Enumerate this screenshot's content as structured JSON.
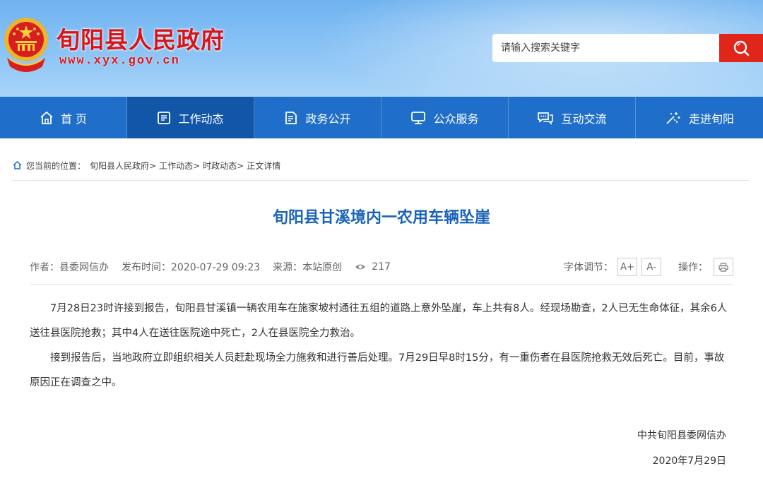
{
  "header": {
    "site_title": "旬阳县人民政府",
    "site_url": "www.xyx.gov.cn",
    "search_placeholder": "请输入搜索关键字",
    "colors": {
      "brand_red": "#d8141b",
      "sky_blue": "#8cc4f5",
      "search_button": "#e0251b"
    }
  },
  "nav": {
    "items": [
      {
        "label": "首 页",
        "icon": "home-icon"
      },
      {
        "label": "工作动态",
        "icon": "document-icon",
        "active": true
      },
      {
        "label": "政务公开",
        "icon": "file-icon"
      },
      {
        "label": "公众服务",
        "icon": "monitor-icon"
      },
      {
        "label": "互动交流",
        "icon": "chat-icon"
      },
      {
        "label": "走进旬阳",
        "icon": "sparkle-icon"
      }
    ],
    "colors": {
      "bar": "#1f6ec9",
      "active": "#1256a8"
    }
  },
  "breadcrumb": {
    "prefix": "您当前的位置：",
    "items": [
      "旬阳县人民政府>",
      "工作动态>",
      "时政动态>",
      "正文详情"
    ]
  },
  "article": {
    "title": "旬阳县甘溪境内一农用车辆坠崖",
    "meta": {
      "author": "作者：县委网信办",
      "published": "发布时间：2020-07-29 09:23",
      "source": "来源：本站原创",
      "views": "217",
      "font_adjust_label": "字体调节：",
      "font_larger": "A+",
      "font_smaller": "A-",
      "operate_label": "操作："
    },
    "paragraphs": [
      "7月28日23时许接到报告，旬阳县甘溪镇一辆农用车在施家坡村通往五组的道路上意外坠崖，车上共有8人。经现场勘查，2人已无生命体征，其余6人送往县医院抢救；其中4人在送往医院途中死亡，2人在县医院全力救治。",
      "接到报告后，当地政府立即组织相关人员赶赴现场全力施救和进行善后处理。7月29日早8时15分，有一重伤者在县医院抢救无效后死亡。目前，事故原因正在调查之中。"
    ],
    "signature": "中共旬阳县委网信办",
    "date": "2020年7月29日",
    "title_color": "#1a64b8"
  }
}
